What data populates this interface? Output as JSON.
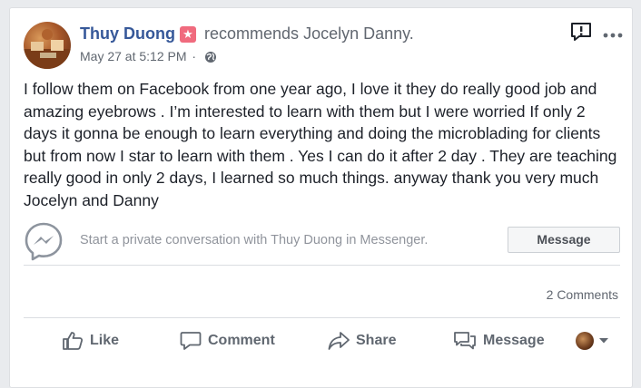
{
  "post": {
    "author": "Thuy Duong",
    "action": "recommends",
    "target": "Jocelyn Danny.",
    "date": "May 27 at 5:12 PM",
    "separator": "·",
    "badge_glyph": "★",
    "body": "I follow them on Facebook from one year ago, I love it they do really good job and amazing eyebrows . I’m interested to learn with them but I were worried If only 2 days it gonna be enough to learn everything and doing the microblading for clients but from now I star to learn with them . Yes I can do it after 2 day . They are teaching really good in only 2 days, I learned so much things. anyway thank you very much Jocelyn and Danny"
  },
  "messenger": {
    "prompt": "Start a private conversation with Thuy Duong in Messenger.",
    "button_label": "Message"
  },
  "comments": {
    "count_label": "2 Comments"
  },
  "actions": {
    "like": "Like",
    "comment": "Comment",
    "share": "Share",
    "message": "Message"
  },
  "colors": {
    "author_link": "#365899",
    "badge": "#f06b7e",
    "muted_text": "#606770",
    "page_bg": "#e9ebee"
  },
  "icons": [
    "globe-icon",
    "report-icon",
    "more-icon",
    "messenger-icon",
    "like-icon",
    "comment-icon",
    "share-icon",
    "message-icon",
    "chevron-down-icon"
  ]
}
